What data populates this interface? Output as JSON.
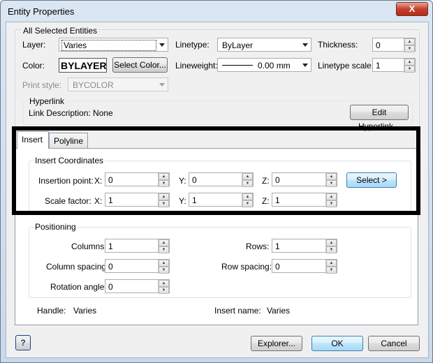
{
  "window": {
    "title": "Entity Properties",
    "close": "X"
  },
  "all_selected": {
    "group_label": "All Selected Entities",
    "layer_label": "Layer:",
    "layer_value": "Varies",
    "linetype_label": "Linetype:",
    "linetype_value": "ByLayer",
    "thickness_label": "Thickness:",
    "thickness_value": "0",
    "color_label": "Color:",
    "color_value": "BYLAYER",
    "select_color_button": "Select Color...",
    "lineweight_label": "Lineweight:",
    "lineweight_value": "0.00 mm",
    "linetype_scale_label": "Linetype scale:",
    "linetype_scale_value": "1",
    "print_style_label": "Print style:",
    "print_style_value": "BYCOLOR"
  },
  "hyperlink": {
    "group_label": "Hyperlink",
    "description": "Link Description: None",
    "edit_button": "Edit Hyperlink..."
  },
  "tabs": [
    {
      "label": "Insert",
      "active": true
    },
    {
      "label": "Polyline",
      "active": false
    }
  ],
  "insert_coordinates": {
    "group_label": "Insert Coordinates",
    "insertion_point_label": "Insertion point:",
    "scale_factor_label": "Scale factor:",
    "x_label": "X:",
    "y_label": "Y:",
    "z_label": "Z:",
    "insertion": {
      "x": "0",
      "y": "0",
      "z": "0"
    },
    "scale": {
      "x": "1",
      "y": "1",
      "z": "1"
    },
    "select_button": "Select >"
  },
  "positioning": {
    "group_label": "Positioning",
    "columns_label": "Columns:",
    "columns_value": "1",
    "rows_label": "Rows:",
    "rows_value": "1",
    "column_spacing_label": "Column spacing:",
    "column_spacing_value": "0",
    "row_spacing_label": "Row spacing:",
    "row_spacing_value": "0",
    "rotation_angle_label": "Rotation angle:",
    "rotation_angle_value": "0"
  },
  "info": {
    "handle_label": "Handle:",
    "handle_value": "Varies",
    "insert_name_label": "Insert name:",
    "insert_name_value": "Varies"
  },
  "footer": {
    "help_icon": "?",
    "explorer_button": "Explorer...",
    "ok_button": "OK",
    "cancel_button": "Cancel"
  },
  "colors": {
    "highlight_box": "#000000",
    "default_button": "#3c7fb1"
  }
}
